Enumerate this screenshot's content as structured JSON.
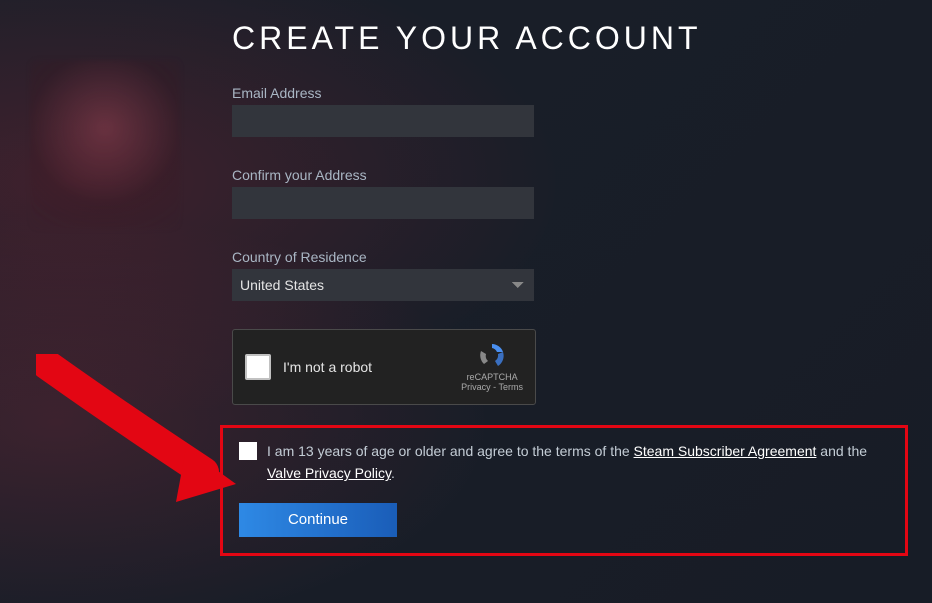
{
  "title": "CREATE YOUR ACCOUNT",
  "fields": {
    "email": {
      "label": "Email Address",
      "value": ""
    },
    "confirm": {
      "label": "Confirm your Address",
      "value": ""
    },
    "country": {
      "label": "Country of Residence",
      "selected": "United States"
    }
  },
  "captcha": {
    "label": "I'm not a robot",
    "brand": "reCAPTCHA",
    "links": "Privacy - Terms"
  },
  "agreement": {
    "prefix": "I am 13 years of age or older and agree to the terms of the ",
    "link1": "Steam Subscriber Agreement",
    "middle": " and the ",
    "link2": "Valve Privacy Policy",
    "suffix": "."
  },
  "continue_label": "Continue"
}
